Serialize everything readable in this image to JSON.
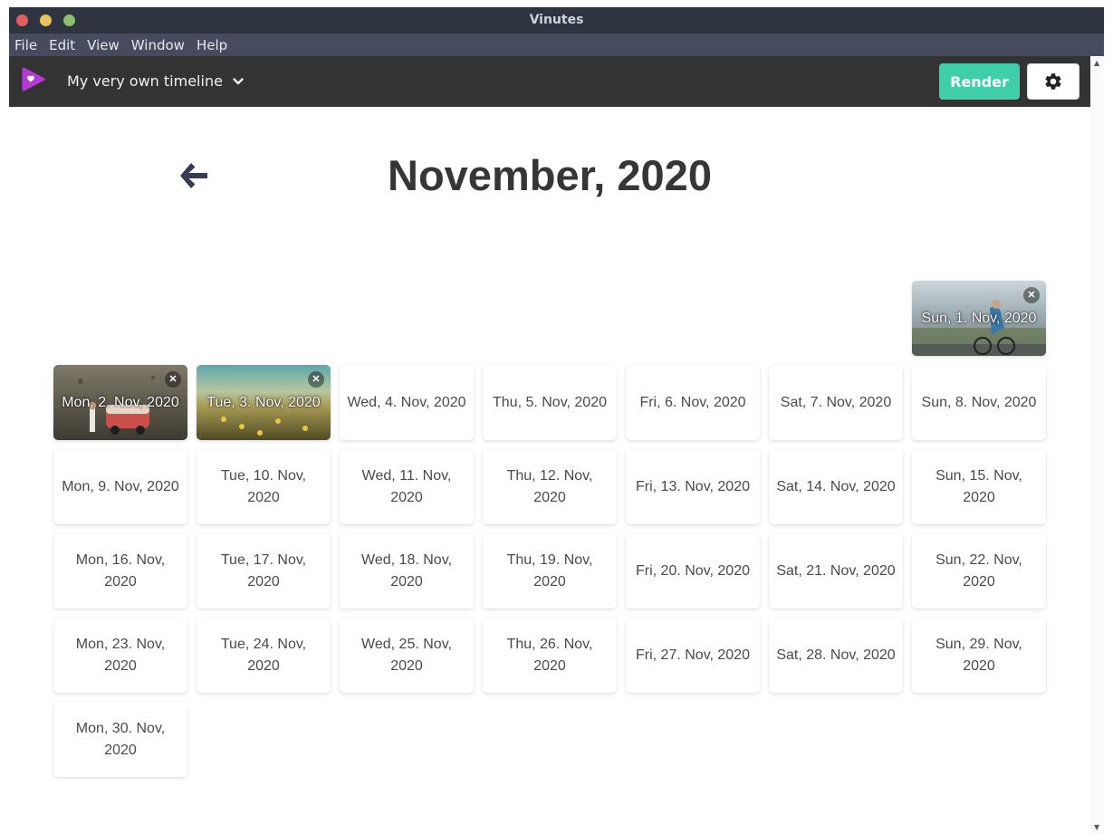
{
  "window": {
    "title": "Vinutes"
  },
  "menu": [
    "File",
    "Edit",
    "View",
    "Window",
    "Help"
  ],
  "appbar": {
    "timeline_name": "My very own timeline",
    "render_label": "Render",
    "accent_color": "#3ecfa8",
    "logo_color": "#b83ad6"
  },
  "calendar": {
    "month_title": "November, 2020",
    "days": [
      {
        "label": "Sun, 1. Nov, 2020",
        "has_clip": true,
        "thumb": "cyclist"
      },
      {
        "label": "Mon, 2. Nov, 2020",
        "has_clip": true,
        "thumb": "van"
      },
      {
        "label": "Tue, 3. Nov, 2020",
        "has_clip": true,
        "thumb": "field"
      },
      {
        "label": "Wed, 4. Nov, 2020",
        "has_clip": false
      },
      {
        "label": "Thu, 5. Nov, 2020",
        "has_clip": false
      },
      {
        "label": "Fri, 6. Nov, 2020",
        "has_clip": false
      },
      {
        "label": "Sat, 7. Nov, 2020",
        "has_clip": false
      },
      {
        "label": "Sun, 8. Nov, 2020",
        "has_clip": false
      },
      {
        "label": "Mon, 9. Nov, 2020",
        "has_clip": false
      },
      {
        "label": "Tue, 10. Nov, 2020",
        "has_clip": false
      },
      {
        "label": "Wed, 11. Nov, 2020",
        "has_clip": false
      },
      {
        "label": "Thu, 12. Nov, 2020",
        "has_clip": false
      },
      {
        "label": "Fri, 13. Nov, 2020",
        "has_clip": false
      },
      {
        "label": "Sat, 14. Nov, 2020",
        "has_clip": false
      },
      {
        "label": "Sun, 15. Nov, 2020",
        "has_clip": false
      },
      {
        "label": "Mon, 16. Nov, 2020",
        "has_clip": false
      },
      {
        "label": "Tue, 17. Nov, 2020",
        "has_clip": false
      },
      {
        "label": "Wed, 18. Nov, 2020",
        "has_clip": false
      },
      {
        "label": "Thu, 19. Nov, 2020",
        "has_clip": false
      },
      {
        "label": "Fri, 20. Nov, 2020",
        "has_clip": false
      },
      {
        "label": "Sat, 21. Nov, 2020",
        "has_clip": false
      },
      {
        "label": "Sun, 22. Nov, 2020",
        "has_clip": false
      },
      {
        "label": "Mon, 23. Nov, 2020",
        "has_clip": false
      },
      {
        "label": "Tue, 24. Nov, 2020",
        "has_clip": false
      },
      {
        "label": "Wed, 25. Nov, 2020",
        "has_clip": false
      },
      {
        "label": "Thu, 26. Nov, 2020",
        "has_clip": false
      },
      {
        "label": "Fri, 27. Nov, 2020",
        "has_clip": false
      },
      {
        "label": "Sat, 28. Nov, 2020",
        "has_clip": false
      },
      {
        "label": "Sun, 29. Nov, 2020",
        "has_clip": false
      },
      {
        "label": "Mon, 30. Nov, 2020",
        "has_clip": false
      }
    ]
  }
}
